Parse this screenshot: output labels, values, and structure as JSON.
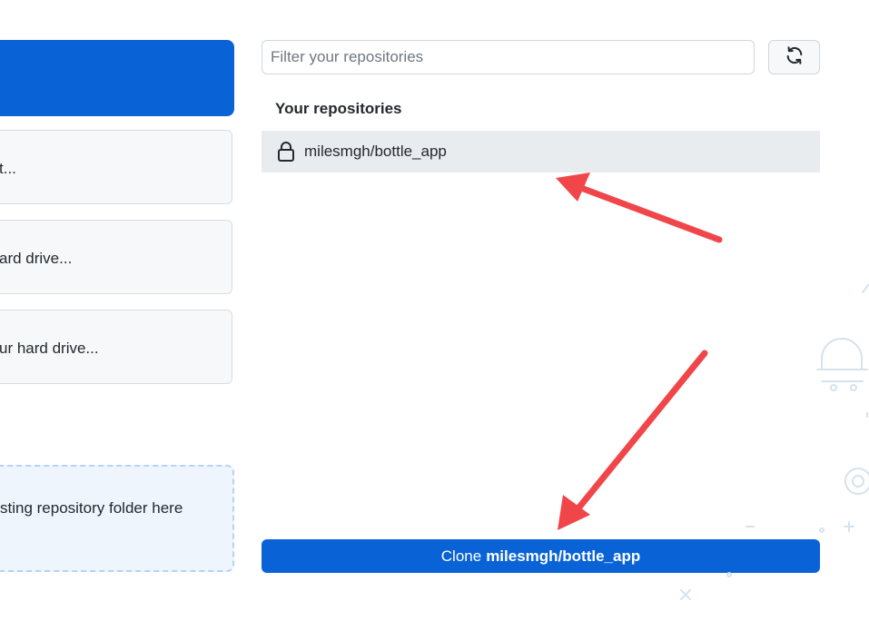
{
  "left_panel": {
    "option_1_label": "t...",
    "option_2_label": "ard drive...",
    "option_3_label": "ur hard drive...",
    "drop_zone_text": "sting repository folder here"
  },
  "filter": {
    "placeholder": "Filter your repositories",
    "value": ""
  },
  "refresh": {
    "icon": "sync-icon"
  },
  "repositories": {
    "section_title": "Your repositories",
    "items": [
      {
        "name": "milesmgh/bottle_app",
        "icon": "lock-icon",
        "selected": true
      }
    ]
  },
  "clone_button": {
    "prefix": "Clone",
    "repo": "milesmgh/bottle_app"
  },
  "colors": {
    "accent": "#0a63d6",
    "annotation_arrow": "#f0464a",
    "selected_row": "#e9ecef"
  }
}
